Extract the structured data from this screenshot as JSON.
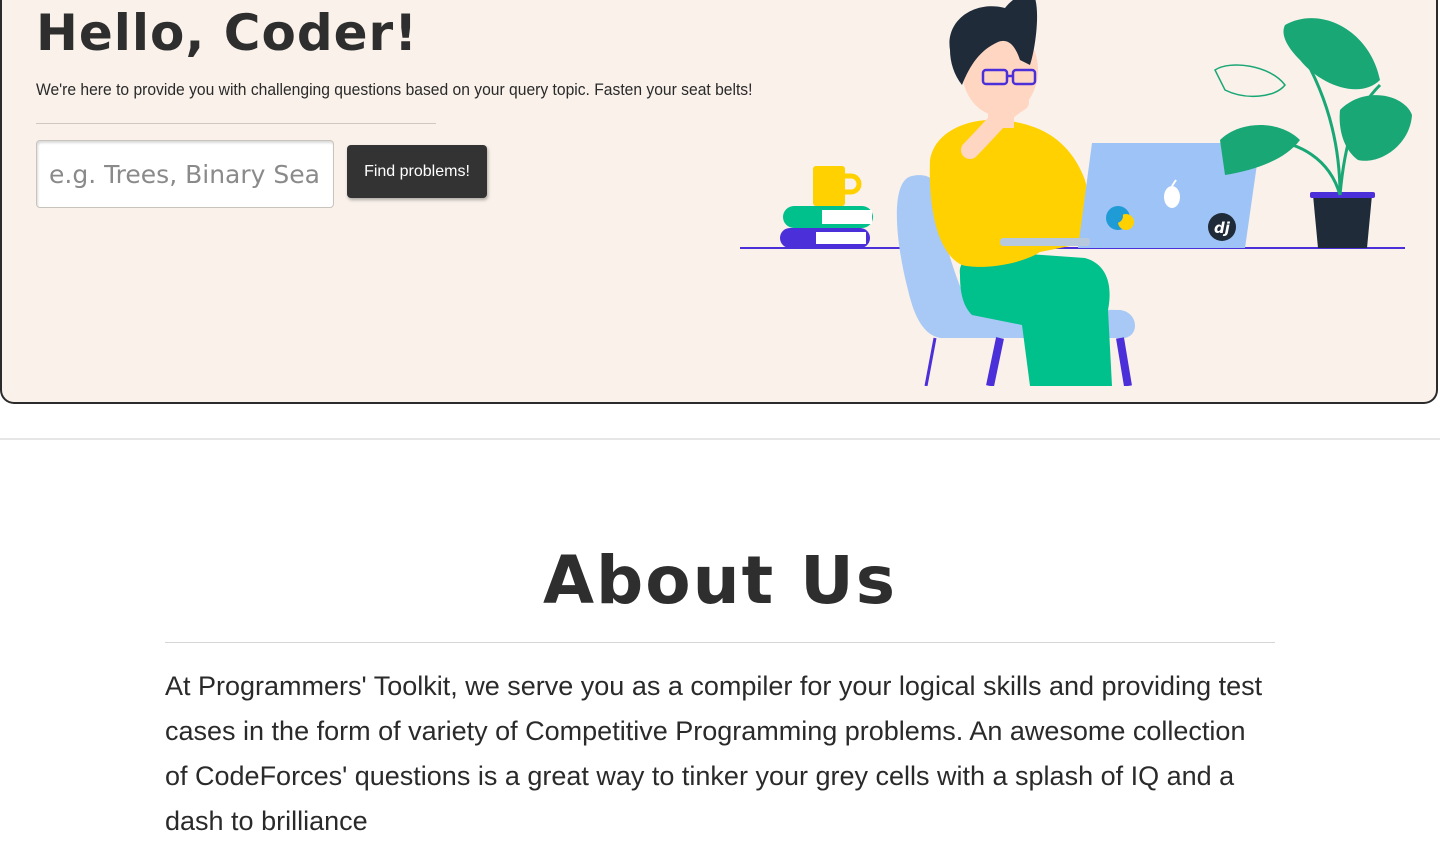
{
  "hero": {
    "title": "Hello, Coder!",
    "subtitle": "We're here to provide you with challenging questions based on your query topic. Fasten your seat belts!",
    "search_placeholder": "e.g. Trees, Binary Search, ...",
    "search_value": "",
    "find_button_label": "Find problems!"
  },
  "about": {
    "title": "About Us",
    "text": "At Programmers' Toolkit, we serve you as a compiler for your logical skills and providing test cases in the form of variety of Competitive Programming problems. An awesome collection of CodeForces' questions is a great way to tinker your grey cells with a splash of IQ and a dash to brilliance"
  },
  "illustration": {
    "icons": [
      "python-logo-icon",
      "apple-logo-icon",
      "django-logo-icon"
    ],
    "badge_text": "dj",
    "colors": {
      "accent": "#4b2fd9",
      "shirt": "#ffd100",
      "pants": "#00c08b",
      "chair": "#a8c9f5",
      "laptop": "#9ec3f7",
      "plant": "#1aa776",
      "hair": "#1f2b38"
    }
  }
}
